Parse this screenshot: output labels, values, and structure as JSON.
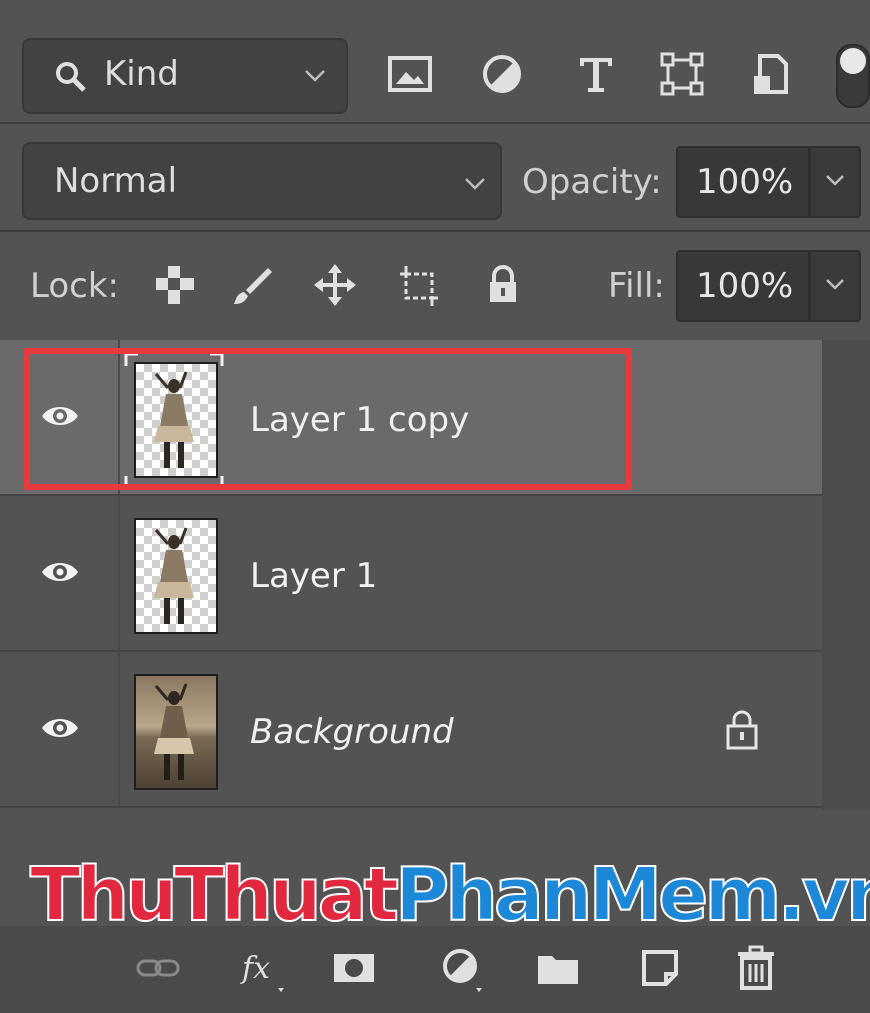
{
  "filter": {
    "kind_label": "Kind"
  },
  "blend": {
    "mode": "Normal",
    "opacity_label": "Opacity:",
    "opacity_value": "100%"
  },
  "lock": {
    "label": "Lock:",
    "fill_label": "Fill:",
    "fill_value": "100%"
  },
  "layers": [
    {
      "name": "Layer 1 copy",
      "selected": true,
      "visible": true,
      "thumb": "checker"
    },
    {
      "name": "Layer 1",
      "selected": false,
      "visible": true,
      "thumb": "checker"
    },
    {
      "name": "Background",
      "selected": false,
      "visible": true,
      "thumb": "photo",
      "locked": true
    }
  ],
  "watermark": {
    "part1": "ThuThuat",
    "part2": "PhanMem.vn"
  },
  "colors": {
    "panel_bg": "#535353",
    "selection": "#6a6a6a",
    "highlight": "#e8393d"
  }
}
